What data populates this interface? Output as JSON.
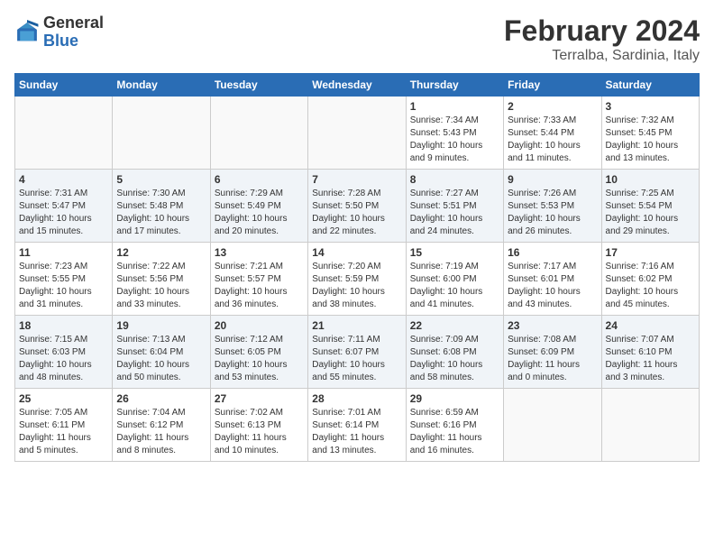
{
  "header": {
    "logo_general": "General",
    "logo_blue": "Blue",
    "title": "February 2024",
    "subtitle": "Terralba, Sardinia, Italy"
  },
  "days_of_week": [
    "Sunday",
    "Monday",
    "Tuesday",
    "Wednesday",
    "Thursday",
    "Friday",
    "Saturday"
  ],
  "weeks": [
    [
      {
        "day": "",
        "info": ""
      },
      {
        "day": "",
        "info": ""
      },
      {
        "day": "",
        "info": ""
      },
      {
        "day": "",
        "info": ""
      },
      {
        "day": "1",
        "info": "Sunrise: 7:34 AM\nSunset: 5:43 PM\nDaylight: 10 hours\nand 9 minutes."
      },
      {
        "day": "2",
        "info": "Sunrise: 7:33 AM\nSunset: 5:44 PM\nDaylight: 10 hours\nand 11 minutes."
      },
      {
        "day": "3",
        "info": "Sunrise: 7:32 AM\nSunset: 5:45 PM\nDaylight: 10 hours\nand 13 minutes."
      }
    ],
    [
      {
        "day": "4",
        "info": "Sunrise: 7:31 AM\nSunset: 5:47 PM\nDaylight: 10 hours\nand 15 minutes."
      },
      {
        "day": "5",
        "info": "Sunrise: 7:30 AM\nSunset: 5:48 PM\nDaylight: 10 hours\nand 17 minutes."
      },
      {
        "day": "6",
        "info": "Sunrise: 7:29 AM\nSunset: 5:49 PM\nDaylight: 10 hours\nand 20 minutes."
      },
      {
        "day": "7",
        "info": "Sunrise: 7:28 AM\nSunset: 5:50 PM\nDaylight: 10 hours\nand 22 minutes."
      },
      {
        "day": "8",
        "info": "Sunrise: 7:27 AM\nSunset: 5:51 PM\nDaylight: 10 hours\nand 24 minutes."
      },
      {
        "day": "9",
        "info": "Sunrise: 7:26 AM\nSunset: 5:53 PM\nDaylight: 10 hours\nand 26 minutes."
      },
      {
        "day": "10",
        "info": "Sunrise: 7:25 AM\nSunset: 5:54 PM\nDaylight: 10 hours\nand 29 minutes."
      }
    ],
    [
      {
        "day": "11",
        "info": "Sunrise: 7:23 AM\nSunset: 5:55 PM\nDaylight: 10 hours\nand 31 minutes."
      },
      {
        "day": "12",
        "info": "Sunrise: 7:22 AM\nSunset: 5:56 PM\nDaylight: 10 hours\nand 33 minutes."
      },
      {
        "day": "13",
        "info": "Sunrise: 7:21 AM\nSunset: 5:57 PM\nDaylight: 10 hours\nand 36 minutes."
      },
      {
        "day": "14",
        "info": "Sunrise: 7:20 AM\nSunset: 5:59 PM\nDaylight: 10 hours\nand 38 minutes."
      },
      {
        "day": "15",
        "info": "Sunrise: 7:19 AM\nSunset: 6:00 PM\nDaylight: 10 hours\nand 41 minutes."
      },
      {
        "day": "16",
        "info": "Sunrise: 7:17 AM\nSunset: 6:01 PM\nDaylight: 10 hours\nand 43 minutes."
      },
      {
        "day": "17",
        "info": "Sunrise: 7:16 AM\nSunset: 6:02 PM\nDaylight: 10 hours\nand 45 minutes."
      }
    ],
    [
      {
        "day": "18",
        "info": "Sunrise: 7:15 AM\nSunset: 6:03 PM\nDaylight: 10 hours\nand 48 minutes."
      },
      {
        "day": "19",
        "info": "Sunrise: 7:13 AM\nSunset: 6:04 PM\nDaylight: 10 hours\nand 50 minutes."
      },
      {
        "day": "20",
        "info": "Sunrise: 7:12 AM\nSunset: 6:05 PM\nDaylight: 10 hours\nand 53 minutes."
      },
      {
        "day": "21",
        "info": "Sunrise: 7:11 AM\nSunset: 6:07 PM\nDaylight: 10 hours\nand 55 minutes."
      },
      {
        "day": "22",
        "info": "Sunrise: 7:09 AM\nSunset: 6:08 PM\nDaylight: 10 hours\nand 58 minutes."
      },
      {
        "day": "23",
        "info": "Sunrise: 7:08 AM\nSunset: 6:09 PM\nDaylight: 11 hours\nand 0 minutes."
      },
      {
        "day": "24",
        "info": "Sunrise: 7:07 AM\nSunset: 6:10 PM\nDaylight: 11 hours\nand 3 minutes."
      }
    ],
    [
      {
        "day": "25",
        "info": "Sunrise: 7:05 AM\nSunset: 6:11 PM\nDaylight: 11 hours\nand 5 minutes."
      },
      {
        "day": "26",
        "info": "Sunrise: 7:04 AM\nSunset: 6:12 PM\nDaylight: 11 hours\nand 8 minutes."
      },
      {
        "day": "27",
        "info": "Sunrise: 7:02 AM\nSunset: 6:13 PM\nDaylight: 11 hours\nand 10 minutes."
      },
      {
        "day": "28",
        "info": "Sunrise: 7:01 AM\nSunset: 6:14 PM\nDaylight: 11 hours\nand 13 minutes."
      },
      {
        "day": "29",
        "info": "Sunrise: 6:59 AM\nSunset: 6:16 PM\nDaylight: 11 hours\nand 16 minutes."
      },
      {
        "day": "",
        "info": ""
      },
      {
        "day": "",
        "info": ""
      }
    ]
  ]
}
